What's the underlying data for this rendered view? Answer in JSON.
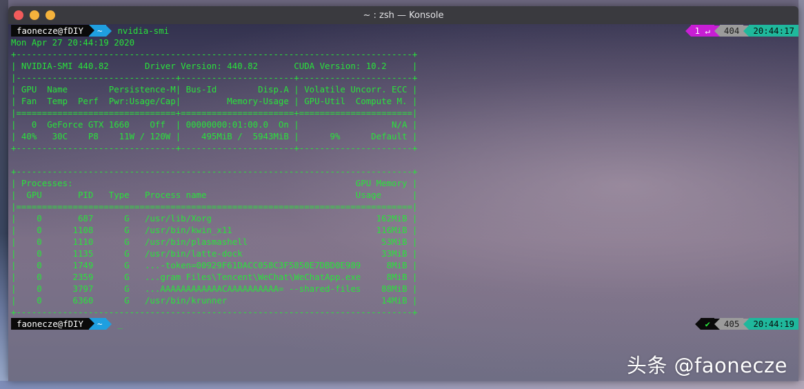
{
  "window": {
    "title": "~ : zsh — Konsole"
  },
  "colors": {
    "terminal_text": "#29e33b",
    "prompt_user_bg": "#0a0a0a",
    "prompt_dir_bg": "#1f9fe0",
    "status_fail_bg": "#c81ed4",
    "history_bg": "#9b9b9b",
    "time_bg": "#1fb89c"
  },
  "prompt1": {
    "user": "faonecze@fDIY",
    "dir": "~",
    "command": "nvidia-smi",
    "status": "1 ↵",
    "history": "404",
    "time": "20:44:17"
  },
  "prompt2": {
    "user": "faonecze@fDIY",
    "dir": "~",
    "cursor": "_",
    "status": "✔",
    "history": "405",
    "time": "20:44:19"
  },
  "output_lines": [
    "Mon Apr 27 20:44:19 2020",
    "+-----------------------------------------------------------------------------+",
    "| NVIDIA-SMI 440.82       Driver Version: 440.82       CUDA Version: 10.2     |",
    "|-------------------------------+----------------------+----------------------+",
    "| GPU  Name        Persistence-M| Bus-Id        Disp.A | Volatile Uncorr. ECC |",
    "| Fan  Temp  Perf  Pwr:Usage/Cap|         Memory-Usage | GPU-Util  Compute M. |",
    "|===============================+======================+======================|",
    "|   0  GeForce GTX 1660    Off  | 00000000:01:00.0  On |                  N/A |",
    "| 40%   30C    P8    11W / 120W |    495MiB /  5943MiB |      9%      Default |",
    "+-------------------------------+----------------------+----------------------+",
    "",
    "+-----------------------------------------------------------------------------+",
    "| Processes:                                                       GPU Memory |",
    "|  GPU       PID   Type   Process name                             Usage      |",
    "|=============================================================================|",
    "|    0       687      G   /usr/lib/Xorg                                162MiB |",
    "|    0      1108      G   /usr/bin/kwin_x11                            116MiB |",
    "|    0      1110      G   /usr/bin/plasmashell                          53MiB |",
    "|    0      1135      G   /usr/bin/latte-dock                           33MiB |",
    "|    0      1749      G   ...-token=00929F61DACC058C3F5850E7DBD0E989     8MiB |",
    "|    0      2359      G   ...gram Files\\Tencent\\WeChat\\WeChatApp.exe     8MiB |",
    "|    0      3797      G   ...AAAAAAAAAAAACAAAAAAAAAA= --shared-files    88MiB |",
    "|    0      6360      G   /usr/bin/krunner                              14MiB |",
    "+-----------------------------------------------------------------------------+"
  ],
  "watermark": "头条 @faonecze"
}
